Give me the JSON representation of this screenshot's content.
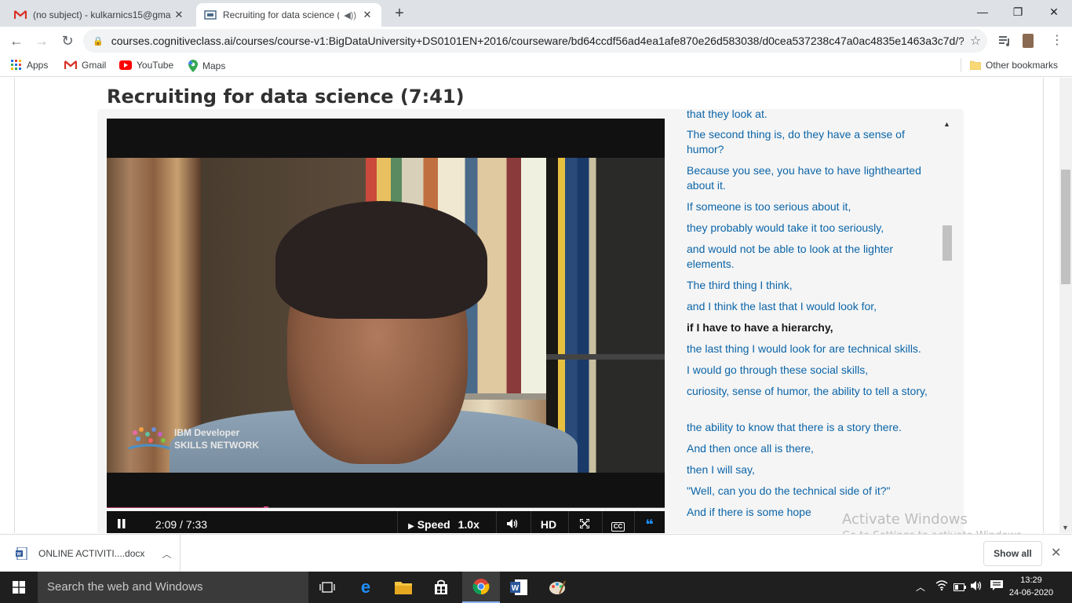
{
  "browser": {
    "tabs": [
      {
        "title": "(no subject) - kulkarnics15@gma",
        "icon": "gmail-icon"
      },
      {
        "title": "Recruiting for data science (",
        "icon": "course-icon",
        "active": true
      }
    ],
    "new_tab": "+",
    "window_controls": {
      "minimize": "—",
      "maximize": "❐",
      "close": "✕"
    },
    "url": "courses.cognitiveclass.ai/courses/course-v1:BigDataUniversity+DS0101EN+2016/courseware/bd64ccdf56ad4ea1afe870e26d583038/d0cea537238c47a0ac4835e1463a3c7d/?...",
    "bookmarks": [
      {
        "label": "Apps",
        "icon": "apps-grid-icon"
      },
      {
        "label": "Gmail",
        "icon": "gmail-icon"
      },
      {
        "label": "YouTube",
        "icon": "youtube-icon"
      },
      {
        "label": "Maps",
        "icon": "maps-icon"
      }
    ],
    "other_bookmarks": "Other bookmarks"
  },
  "video": {
    "title": "Recruiting for data science (7:41)",
    "watermark_line1": "IBM Developer",
    "watermark_line2": "SKILLS NETWORK",
    "time": "2:09 / 7:33",
    "progress_fraction": 0.2848,
    "speed_label": "Speed",
    "speed_value": "1.0x",
    "hd_label": "HD",
    "cc_label": "CC"
  },
  "transcript": [
    {
      "text": "that they look at.",
      "current": false
    },
    {
      "text": "The second thing is, do they have a sense of humor?",
      "current": false
    },
    {
      "text": "Because you see, you have to have lighthearted about it.",
      "current": false
    },
    {
      "text": "If someone is too serious about it,",
      "current": false
    },
    {
      "text": "they probably would take it too seriously,",
      "current": false
    },
    {
      "text": "and would not be able to look at the lighter elements.",
      "current": false
    },
    {
      "text": "The third thing I think,",
      "current": false
    },
    {
      "text": "and I think the last that I would look for,",
      "current": false
    },
    {
      "text": "if I have to have a hierarchy,",
      "current": true
    },
    {
      "text": "the last thing I would look for are technical skills.",
      "current": false
    },
    {
      "text": "I would go through these social skills,",
      "current": false
    },
    {
      "text": "curiosity, sense of humor, the ability to tell a story,",
      "current": false
    },
    {
      "text": "the ability to know that there is a story there.",
      "current": false
    },
    {
      "text": "And then once all is there,",
      "current": false
    },
    {
      "text": "then I will say,",
      "current": false
    },
    {
      "text": "\"Well, can you do the technical side of it?\"",
      "current": false
    },
    {
      "text": "And if there is some hope",
      "current": false
    }
  ],
  "watermark": {
    "line1": "Activate Windows",
    "line2": "Go to Settings to activate Windows."
  },
  "downloads": {
    "file": "ONLINE ACTIVITI....docx",
    "show_all": "Show all"
  },
  "taskbar": {
    "search_placeholder": "Search the web and Windows",
    "time": "13:29",
    "date": "24-06-2020"
  },
  "colors": {
    "link": "#0c65a8",
    "progress": "#b5386a",
    "taskbar": "#1f1f1f"
  }
}
